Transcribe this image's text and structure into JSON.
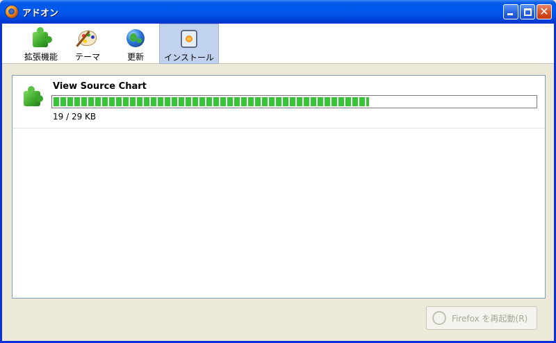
{
  "window": {
    "title": "アドオン"
  },
  "toolbar": {
    "tabs": [
      {
        "label": "拡張機能",
        "icon": "puzzle-icon"
      },
      {
        "label": "テーマ",
        "icon": "palette-icon"
      },
      {
        "label": "更新",
        "icon": "globe-icon"
      },
      {
        "label": "インストール",
        "icon": "install-icon",
        "selected": true
      }
    ]
  },
  "download": {
    "name": "View Source Chart",
    "status": "19 / 29 KB",
    "progress_fraction": 0.655
  },
  "footer": {
    "restart_label": "Firefox を再起動(R)",
    "restart_enabled": false
  },
  "colors": {
    "titlebar": "#0058ee",
    "progress": "#37c537",
    "selected_tab": "#c1d2ee"
  }
}
